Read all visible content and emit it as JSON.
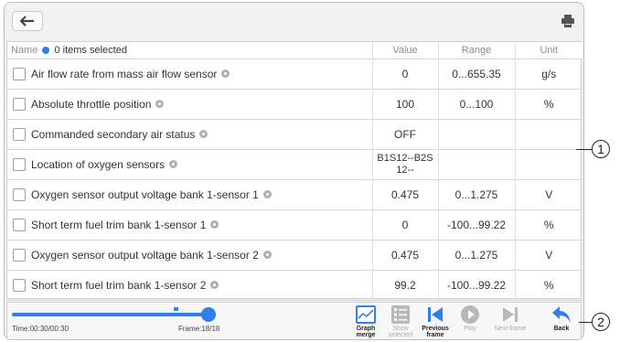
{
  "header": {
    "back_icon": "arrow-left-icon",
    "print_icon": "printer-icon"
  },
  "table": {
    "columns": {
      "name": "Name",
      "selected": "0 items selected",
      "value": "Value",
      "range": "Range",
      "unit": "Unit"
    },
    "rows": [
      {
        "name": "Air flow rate from mass air flow sensor",
        "value": "0",
        "range": "0...655.35",
        "unit": "g/s"
      },
      {
        "name": "Absolute throttle position",
        "value": "100",
        "range": "0...100",
        "unit": "%"
      },
      {
        "name": "Commanded secondary air status",
        "value": "OFF",
        "range": "",
        "unit": ""
      },
      {
        "name": "Location of oxygen sensors",
        "value": "B1S12--B2S\n12--",
        "range": "",
        "unit": ""
      },
      {
        "name": "Oxygen sensor output voltage bank 1-sensor 1",
        "value": "0.475",
        "range": "0...1.275",
        "unit": "V"
      },
      {
        "name": "Short term fuel trim bank 1-sensor 1",
        "value": "0",
        "range": "-100...99.22",
        "unit": "%"
      },
      {
        "name": "Oxygen sensor output voltage bank 1-sensor 2",
        "value": "0.475",
        "range": "0...1.275",
        "unit": "V"
      },
      {
        "name": "Short term fuel trim bank 1-sensor 2",
        "value": "99.2",
        "range": "-100...99.22",
        "unit": "%"
      }
    ]
  },
  "playback": {
    "time": "Time:00:30/00:30",
    "frame": "Frame:18/18",
    "progress": 1.0
  },
  "toolbar": {
    "graph_merge": "Graph merge",
    "show_selected": "Show selected",
    "previous_frame": "Previous frame",
    "play": "Play",
    "next_frame": "Next frame",
    "back": "Back"
  },
  "callouts": {
    "one": "1",
    "two": "2"
  },
  "colors": {
    "accent": "#2f80ed",
    "disabled": "#b8b8b8"
  }
}
